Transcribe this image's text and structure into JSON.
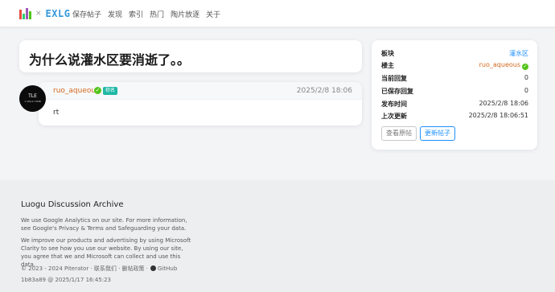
{
  "brand": {
    "separator": "×",
    "name": "EXLG"
  },
  "nav": {
    "items": [
      {
        "label": "保存帖子"
      },
      {
        "label": "发现"
      },
      {
        "label": "索引"
      },
      {
        "label": "热门"
      },
      {
        "label": "陶片放逐"
      },
      {
        "label": "关于"
      }
    ]
  },
  "post": {
    "title": "为什么说灌水区要消逝了。。"
  },
  "reply": {
    "avatar_text": "TLE",
    "avatar_sub": "1.26s/1.11MB",
    "author": "ruo_aqueous",
    "verified_icon": "check-circle-icon",
    "badge": "棕名",
    "time": "2025/2/8 18:06",
    "content": "rt"
  },
  "info": {
    "rows": [
      {
        "key": "板块",
        "value": "灌水区"
      },
      {
        "key": "楼主",
        "value": "ruo_aqueous"
      },
      {
        "key": "当前回复",
        "value": "0"
      },
      {
        "key": "已保存回复",
        "value": "0"
      },
      {
        "key": "发布时间",
        "value": "2025/2/8 18:06"
      },
      {
        "key": "上次更新",
        "value": "2025/2/8 18:06:51"
      }
    ],
    "view_button": "查看原帖",
    "update_button": "更新帖子"
  },
  "footer": {
    "title": "Luogu Discussion Archive",
    "paragraph1": "We use Google Analytics on our site. For more information, see Google's Privacy & Terms and Safeguarding your data.",
    "paragraph2": "We improve our products and advertising by using Microsoft Clarity to see how you use our website. By using our site, you agree that we and Microsoft can collect and use this data.",
    "copyright": "© 2023 - 2024 Piterator · 联系我们 · 删帖政策 ·",
    "github": "GitHub",
    "build": "1b83a89 @ 2025/1/17 16:45:23"
  },
  "colors": {
    "accent": "#1e90ff",
    "username": "#d2691e",
    "verified": "#52c41a",
    "badge": "#1fb8a6"
  }
}
